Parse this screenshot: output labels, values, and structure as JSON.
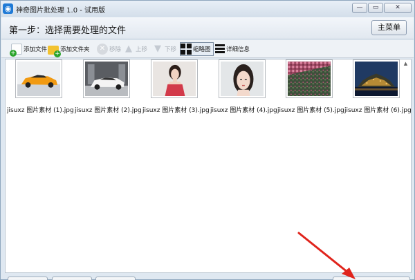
{
  "window": {
    "title": "神奇图片批处理 1.0 - 试用版",
    "controls": {
      "minimize": "—",
      "maximize": "▭",
      "close": "✕"
    }
  },
  "header": {
    "step_title": "第一步：选择需要处理的文件",
    "main_menu_label": "主菜单"
  },
  "toolbar": {
    "add_file": "添加文件",
    "add_folder": "添加文件夹",
    "remove": "移除",
    "move_up": "上移",
    "move_down": "下移",
    "thumbnail_view": "缩略图",
    "detail_view": "详细信息"
  },
  "files": [
    {
      "name": "jisuxz 图片素材 (1).jpg",
      "thumb": "orange-sports-car"
    },
    {
      "name": "jisuxz 图片素材 (2).jpg",
      "thumb": "white-sports-car"
    },
    {
      "name": "jisuxz 图片素材 (3).jpg",
      "thumb": "woman-portrait-red-dress"
    },
    {
      "name": "jisuxz 图片素材 (4).jpg",
      "thumb": "woman-portrait-closeup"
    },
    {
      "name": "jisuxz 图片素材 (5).jpg",
      "thumb": "flower-field"
    },
    {
      "name": "jisuxz 图片素材 (6).jpg",
      "thumb": "night-city-island"
    }
  ],
  "colors": {
    "annotation_arrow": "#e0241c",
    "window_bg": "#dfe8f1",
    "content_bg": "#ffffff"
  }
}
